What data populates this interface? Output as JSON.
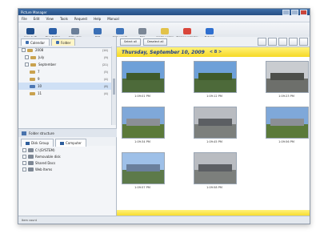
{
  "window": {
    "title": "Picture Manager"
  },
  "menu": [
    "File",
    "Edit",
    "View",
    "Tools",
    "Request",
    "Help",
    "Manual"
  ],
  "toolbar": [
    {
      "label": "Copy to IR",
      "icon": "camera-icon",
      "color": "#1f4e8c"
    },
    {
      "label": "Face finding",
      "icon": "person-icon",
      "color": "#2b5fa8"
    },
    {
      "label": "Slide show",
      "icon": "slideshow-icon",
      "color": "#6b7f99"
    },
    {
      "label": "Edit",
      "icon": "pencil-icon",
      "color": "#3a6fb5"
    },
    {
      "label": "Slide search",
      "icon": "search-icon",
      "color": "#3c72b8"
    },
    {
      "label": "Mail",
      "icon": "mail-icon",
      "color": "#7b8796"
    },
    {
      "label": "Create a label",
      "icon": "label-icon",
      "color": "#e2c24a"
    },
    {
      "label": "Progress indicator",
      "icon": "progress-icon",
      "color": "#d9463b"
    },
    {
      "label": "Network",
      "icon": "globe-icon",
      "color": "#2f6fcf"
    }
  ],
  "left_tabs": [
    {
      "label": "Calendar",
      "active": false
    },
    {
      "label": "Folder",
      "active": true
    }
  ],
  "tree": [
    {
      "label": "2008",
      "count": "(14)"
    },
    {
      "label": "July",
      "count": "(9)"
    },
    {
      "label": "September",
      "count": "(21)"
    },
    {
      "label": "7",
      "count": "(5)"
    },
    {
      "label": "9",
      "count": "(4)"
    },
    {
      "label": "10",
      "count": "(8)",
      "selected": true
    },
    {
      "label": "11",
      "count": "(4)"
    }
  ],
  "folder_structure": {
    "title": "Folder structure",
    "tabs": [
      {
        "label": "Disk Group",
        "active": false
      },
      {
        "label": "Computer",
        "active": true
      }
    ],
    "items": [
      "C:\\(SYSTEM)",
      "Removable disk",
      "Shared Docs",
      "Web Items"
    ]
  },
  "main_toolbar": {
    "buttons": [
      "Select all",
      "Deselect all"
    ],
    "view_buttons": [
      "view-1",
      "view-2",
      "view-3",
      "view-4",
      "view-5"
    ]
  },
  "date_banner": {
    "date": "Thursday, September 10, 2009",
    "count": "< 8 >"
  },
  "thumbnails": [
    {
      "time": "1:09:01 PM",
      "scene": "tree",
      "col": 0,
      "row": 0
    },
    {
      "time": "1:09:12 PM",
      "scene": "tree",
      "col": 1,
      "row": 0
    },
    {
      "time": "1:09:23 PM",
      "scene": "tree-gray",
      "col": 2,
      "row": 0
    },
    {
      "time": "1:09:34 PM",
      "scene": "building",
      "col": 0,
      "row": 1
    },
    {
      "time": "1:09:45 PM",
      "scene": "building-gray",
      "col": 1,
      "row": 1
    },
    {
      "time": "1:09:56 PM",
      "scene": "building",
      "col": 2,
      "row": 1
    },
    {
      "time": "1:09:57 PM",
      "scene": "building-blue",
      "col": 0,
      "row": 2
    },
    {
      "time": "1:09:58 PM",
      "scene": "building-gray",
      "col": 1,
      "row": 2
    }
  ],
  "status": {
    "text": "Item count"
  },
  "colors": {
    "banner": "#f6d925",
    "banner_text": "#1f3f8f",
    "selection": "#cfe0f5"
  }
}
